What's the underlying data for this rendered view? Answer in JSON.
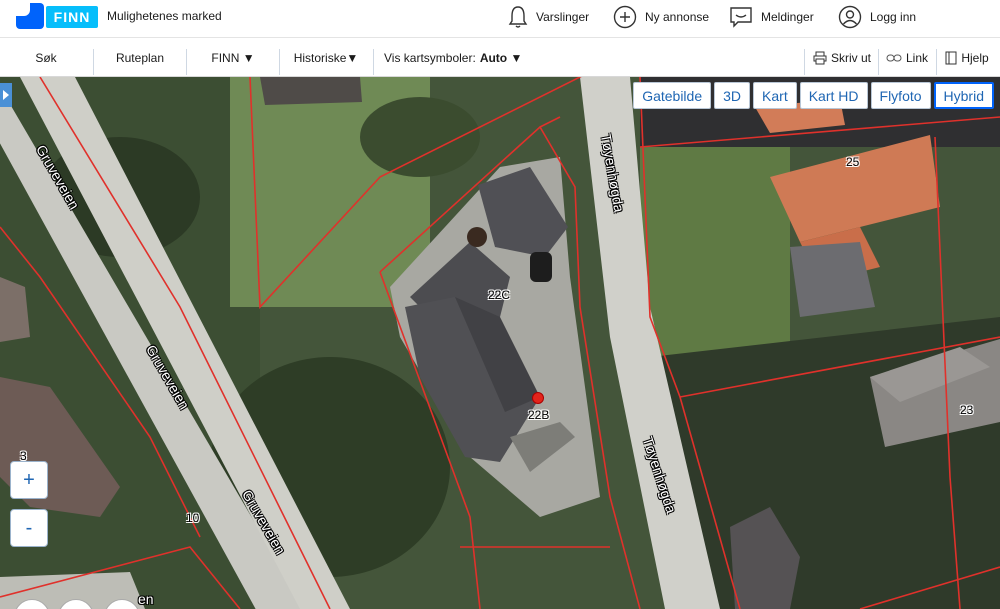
{
  "header": {
    "brand": "FINN",
    "tagline": "Mulighetenes marked",
    "nav": [
      {
        "label": "Varslinger",
        "icon": "bell-icon"
      },
      {
        "label": "Ny annonse",
        "icon": "plus-circle-icon"
      },
      {
        "label": "Meldinger",
        "icon": "chat-icon"
      },
      {
        "label": "Logg inn",
        "icon": "user-icon"
      }
    ]
  },
  "toolbar": {
    "search": "Søk",
    "route": "Ruteplan",
    "finn": "FINN ▼",
    "history": "Historiske▼",
    "symbols_label": "Vis kartsymboler:",
    "symbols_value": "Auto ▼",
    "print": "Skriv ut",
    "link": "Link",
    "help": "Hjelp"
  },
  "map": {
    "types": [
      "Gatebilde",
      "3D",
      "Kart",
      "Kart HD",
      "Flyfoto",
      "Hybrid"
    ],
    "active_type": "Hybrid",
    "zoom_in": "+",
    "zoom_out": "-",
    "streets": [
      "Gruveveien",
      "Gruveveien",
      "Gruveveien",
      "Tøyenhøgda",
      "Tøyenhøgda",
      "en"
    ],
    "house_numbers": [
      "22C",
      "22B",
      "25",
      "23",
      "10",
      "3"
    ],
    "colors": {
      "property_line": "#e0312b",
      "road": "#c9c9c3",
      "active_border": "#0063fb",
      "link_blue": "#1f66b3"
    }
  }
}
